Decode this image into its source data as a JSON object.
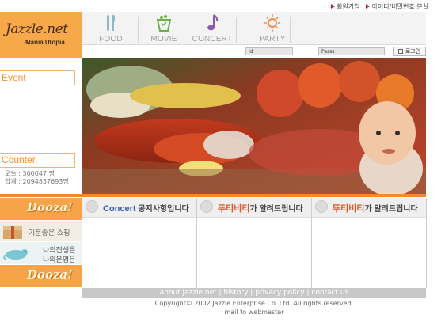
{
  "top_links": {
    "join": "회원가입",
    "find_account": "아이디/비밀번호 분실"
  },
  "logo": {
    "name": "Jazzle.net",
    "tagline": "Mania Utopia"
  },
  "nav": {
    "items": [
      {
        "label": "FOOD",
        "icon": "fork-knife-icon"
      },
      {
        "label": "MOVIE",
        "icon": "popcorn-icon"
      },
      {
        "label": "CONCERT",
        "icon": "music-note-icon"
      },
      {
        "label": "PARTY",
        "icon": "sun-icon"
      }
    ]
  },
  "login": {
    "id_label": "Id",
    "password_label": "Passs",
    "button_label": "로그인"
  },
  "sidebar": {
    "event_title": "Event",
    "counter_title": "Counter",
    "today_line": "오늘 : 300047 명",
    "total_line": "합계 : 2094857693명"
  },
  "banners": {
    "dooza_top": "Dooza!",
    "banner1_text": "기분좋은 쇼핑",
    "banner2_line1": "나의전생은",
    "banner2_line2": "나의운명은",
    "dooza_bottom": "Dooza!"
  },
  "notices": {
    "col1_title_a": "Concert",
    "col1_title_b": " 공지사항입니다",
    "col2_title_a": "뚜티비티",
    "col2_title_b": "가 알려드립니다",
    "col3_title_a": "뚜티비티",
    "col3_title_b": "가 알려드립니다"
  },
  "footer": {
    "about": "about jazzle.net",
    "history": "history",
    "privacy": "privacy policy",
    "contact": "contact us",
    "sep": "|",
    "copyright": "Copyright© 2002 Jazzle Enterprise Co. Ltd. All rights reserved.",
    "mail": "mail to webmaster"
  },
  "colors": {
    "accent": "#f08a2c",
    "logo_bg": "#f7a949",
    "nav_text": "#a0a0a0",
    "link_marker": "#c0185a"
  }
}
